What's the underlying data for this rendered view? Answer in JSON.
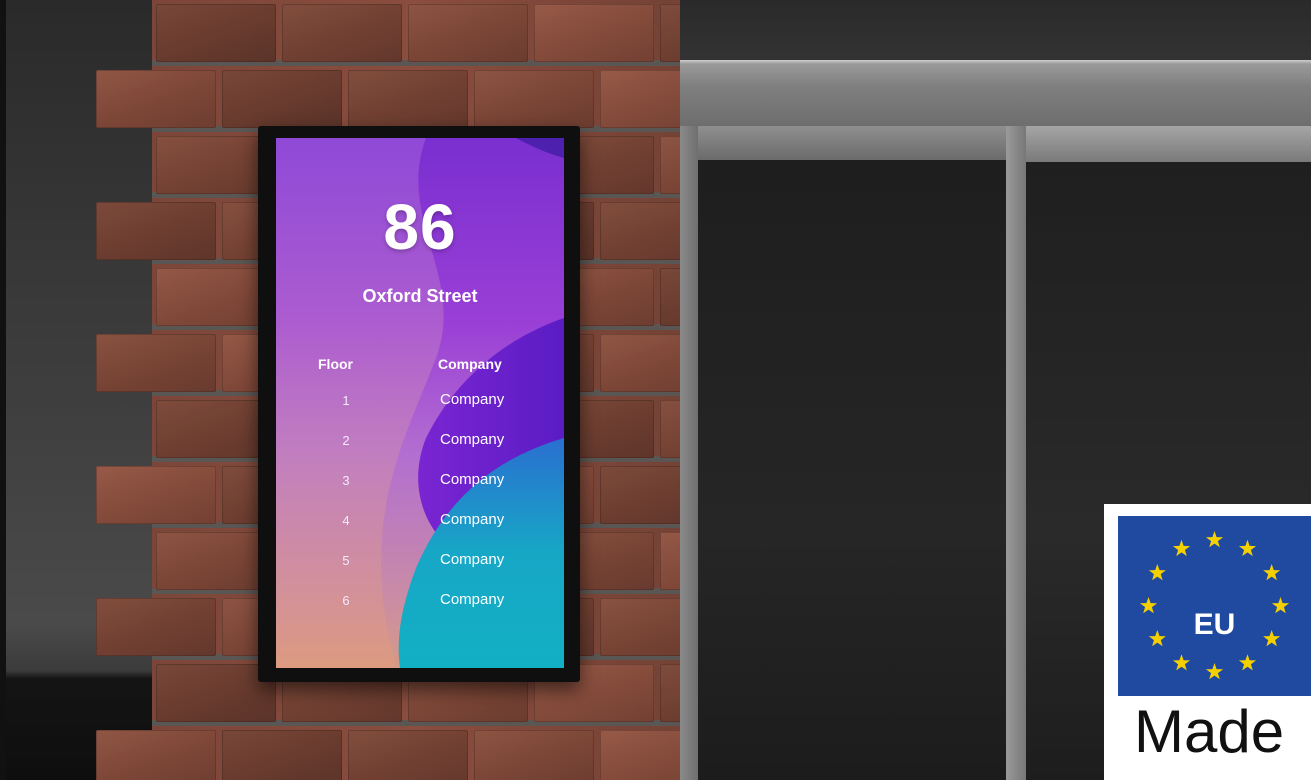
{
  "display": {
    "address_number": "86",
    "street_name": "Oxford Street",
    "column_floor": "Floor",
    "column_company": "Company",
    "rows": [
      {
        "floor": "1",
        "company": "Company"
      },
      {
        "floor": "2",
        "company": "Company"
      },
      {
        "floor": "3",
        "company": "Company"
      },
      {
        "floor": "4",
        "company": "Company"
      },
      {
        "floor": "5",
        "company": "Company"
      },
      {
        "floor": "6",
        "company": "Company"
      }
    ]
  },
  "badge": {
    "flag_text": "EU",
    "made_text": "Made",
    "flag_color": "#1f4aa0",
    "star_color": "#f5d000"
  },
  "colors": {
    "screen_purple": "#7a2fd0",
    "screen_teal": "#1aa6c4",
    "brick": "#7a4536"
  }
}
